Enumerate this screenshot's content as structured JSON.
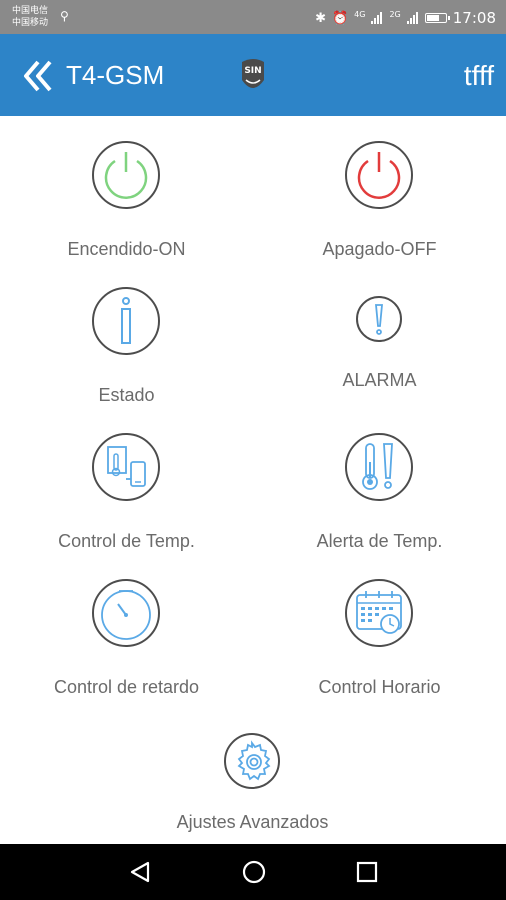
{
  "statusbar": {
    "carrier_1": "中国电信",
    "carrier_2": "中国移动",
    "signal_label_1": "4G",
    "signal_label_2": "2G",
    "time": "17:08"
  },
  "appbar": {
    "title": "T4-GSM",
    "logo_text": "SIN",
    "right_label": "tfff"
  },
  "menu": {
    "items": [
      {
        "label": "Encendido-ON",
        "icon": "power-on-icon",
        "color": "#7fd37f"
      },
      {
        "label": "Apagado-OFF",
        "icon": "power-off-icon",
        "color": "#e23c3c"
      },
      {
        "label": "Estado",
        "icon": "info-icon",
        "color": "#5aa9e6"
      },
      {
        "label": "ALARMA",
        "icon": "exclamation-icon",
        "color": "#5aa9e6"
      },
      {
        "label": "Control de Temp.",
        "icon": "thermometer-phone-icon",
        "color": "#5aa9e6"
      },
      {
        "label": "Alerta de Temp.",
        "icon": "thermometer-alert-icon",
        "color": "#5aa9e6"
      },
      {
        "label": "Control de retardo",
        "icon": "timer-icon",
        "color": "#5aa9e6"
      },
      {
        "label": "Control Horario",
        "icon": "calendar-clock-icon",
        "color": "#5aa9e6"
      },
      {
        "label": "Ajustes Avanzados",
        "icon": "gear-icon",
        "color": "#5aa9e6"
      }
    ]
  },
  "colors": {
    "appbar": "#2d84c8",
    "statusbar": "#8a8a8a",
    "icon_ring": "#4d4d4d",
    "label": "#6b6b6b"
  }
}
